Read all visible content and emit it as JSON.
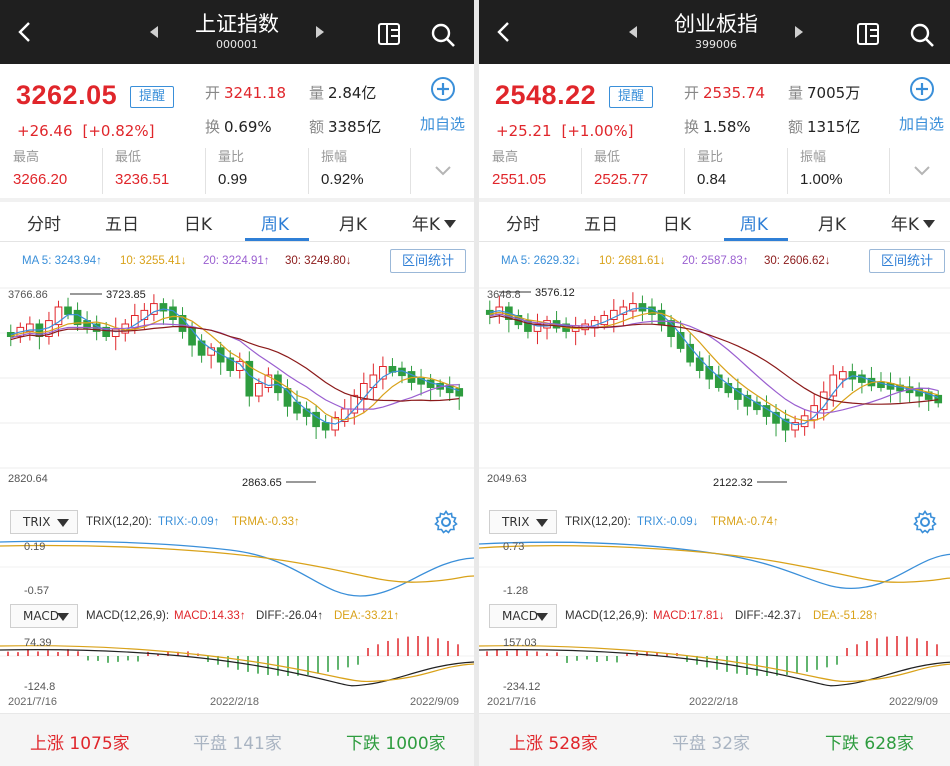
{
  "panels": [
    {
      "title": "上证指数",
      "code": "000001",
      "price": "3262.05",
      "change": "+26.46",
      "change_pct": "[+0.82%]",
      "alert_label": "提醒",
      "open_label": "开",
      "open": "3241.18",
      "volume_label": "量",
      "volume": "2.84亿",
      "turnover_label": "换",
      "turnover": "0.69%",
      "amount_label": "额",
      "amount": "3385亿",
      "add_label": "加自选",
      "high_label": "最高",
      "high": "3266.20",
      "low_label": "最低",
      "low": "3236.51",
      "vol_ratio_label": "量比",
      "vol_ratio": "0.99",
      "amplitude_label": "振幅",
      "amplitude": "0.92%",
      "tabs": [
        "分时",
        "五日",
        "日K",
        "周K",
        "月K",
        "年K"
      ],
      "active_tab": "周K",
      "ma": {
        "ma5": "MA 5: 3243.94↑",
        "ma10": "10: 3255.41↓",
        "ma20": "20: 3224.91↑",
        "ma30": "30: 3249.80↓"
      },
      "range_label": "区间统计",
      "kline_axis": {
        "top": "3766.86",
        "bottom": "2820.64",
        "max_label": "3723.85",
        "min_label": "2863.65"
      },
      "trix": {
        "selector": "TRIX",
        "params": "TRIX(12,20):",
        "trix": "TRIX:-0.09↑",
        "trma": "TRMA:-0.33↑",
        "top": "0.19",
        "bottom": "-0.57"
      },
      "macd": {
        "selector": "MACD",
        "params": "MACD(12,26,9):",
        "macd": "MACD:14.33↑",
        "diff": "DIFF:-26.04↑",
        "dea": "DEA:-33.21↑",
        "top": "74.39",
        "bottom": "-124.8"
      },
      "dates": [
        "2021/7/16",
        "2022/2/18",
        "2022/9/09"
      ],
      "up_label": "上涨",
      "up_count": "1075家",
      "flat_label": "平盘",
      "flat_count": "141家",
      "down_label": "下跌",
      "down_count": "1000家"
    },
    {
      "title": "创业板指",
      "code": "399006",
      "price": "2548.22",
      "change": "+25.21",
      "change_pct": "[+1.00%]",
      "alert_label": "提醒",
      "open_label": "开",
      "open": "2535.74",
      "volume_label": "量",
      "volume": "7005万",
      "turnover_label": "换",
      "turnover": "1.58%",
      "amount_label": "额",
      "amount": "1315亿",
      "add_label": "加自选",
      "high_label": "最高",
      "high": "2551.05",
      "low_label": "最低",
      "low": "2525.77",
      "vol_ratio_label": "量比",
      "vol_ratio": "0.84",
      "amplitude_label": "振幅",
      "amplitude": "1.00%",
      "tabs": [
        "分时",
        "五日",
        "日K",
        "周K",
        "月K",
        "年K"
      ],
      "active_tab": "周K",
      "ma": {
        "ma5": "MA 5: 2629.32↓",
        "ma10": "10: 2681.61↓",
        "ma20": "20: 2587.83↑",
        "ma30": "30: 2606.62↓"
      },
      "range_label": "区间统计",
      "kline_axis": {
        "top": "3648.8",
        "bottom": "2049.63",
        "max_label": "3576.12",
        "min_label": "2122.32"
      },
      "trix": {
        "selector": "TRIX",
        "params": "TRIX(12,20):",
        "trix": "TRIX:-0.09↓",
        "trma": "TRMA:-0.74↑",
        "top": "0.73",
        "bottom": "-1.28"
      },
      "macd": {
        "selector": "MACD",
        "params": "MACD(12,26,9):",
        "macd": "MACD:17.81↓",
        "diff": "DIFF:-42.37↓",
        "dea": "DEA:-51.28↑",
        "top": "157.03",
        "bottom": "-234.12"
      },
      "dates": [
        "2021/7/16",
        "2022/2/18",
        "2022/9/09"
      ],
      "up_label": "上涨",
      "up_count": "528家",
      "flat_label": "平盘",
      "flat_count": "32家",
      "down_label": "下跌",
      "down_count": "628家"
    }
  ],
  "colors": {
    "up": "#e0262b",
    "down": "#2e9c3f",
    "accent": "#2f7fd6",
    "ma5": "#3a8fd9",
    "ma10": "#d9a21a",
    "ma20": "#9a5fd0",
    "ma30": "#8b1a1a",
    "flat": "#a9b4c2"
  }
}
